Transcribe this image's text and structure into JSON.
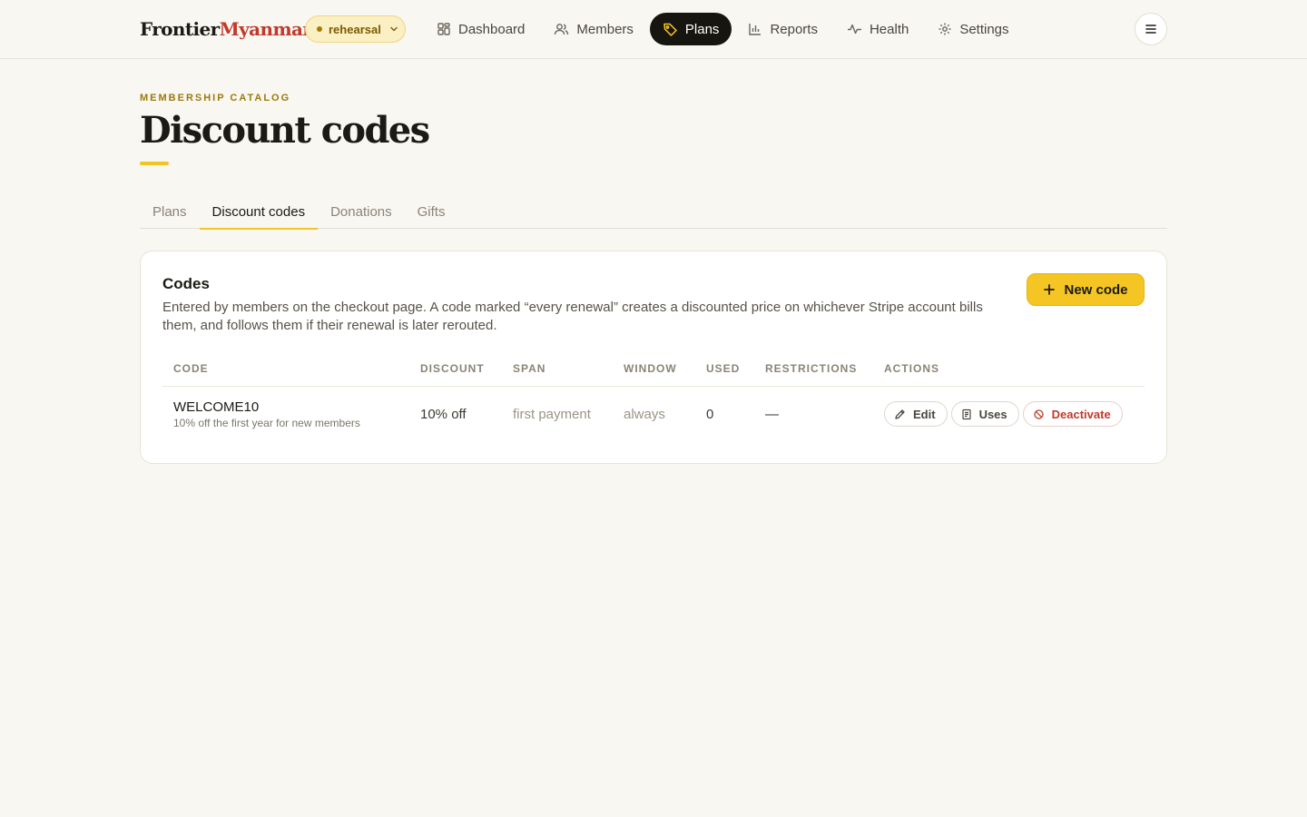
{
  "brand": {
    "part1": "Frontier",
    "part2": "Myanmar"
  },
  "environment": {
    "label": "rehearsal"
  },
  "nav": {
    "items": [
      {
        "label": "Dashboard",
        "icon": "grid-icon"
      },
      {
        "label": "Members",
        "icon": "users-icon"
      },
      {
        "label": "Plans",
        "icon": "tag-icon",
        "active": true
      },
      {
        "label": "Reports",
        "icon": "bar-chart-icon"
      },
      {
        "label": "Health",
        "icon": "pulse-icon"
      },
      {
        "label": "Settings",
        "icon": "gear-icon"
      }
    ]
  },
  "header": {
    "eyebrow": "MEMBERSHIP CATALOG",
    "title": "Discount codes"
  },
  "tabs": [
    {
      "label": "Plans"
    },
    {
      "label": "Discount codes",
      "active": true
    },
    {
      "label": "Donations"
    },
    {
      "label": "Gifts"
    }
  ],
  "codes_card": {
    "title": "Codes",
    "description": "Entered by members on the checkout page. A code marked “every renewal” creates a discounted price on whichever Stripe account bills them, and follows them if their renewal is later rerouted.",
    "new_button": "New code",
    "columns": [
      "CODE",
      "DISCOUNT",
      "SPAN",
      "WINDOW",
      "USED",
      "RESTRICTIONS",
      "ACTIONS"
    ],
    "rows": [
      {
        "code": "WELCOME10",
        "note": "10% off the first year for new members",
        "discount": "10% off",
        "span": "first payment",
        "window": "always",
        "used": "0",
        "restrictions": "—",
        "actions": {
          "edit": "Edit",
          "uses": "Uses",
          "deactivate": "Deactivate"
        }
      }
    ]
  },
  "colors": {
    "background": "#f9f7f2",
    "accent": "#f5c623",
    "active_nav": "#17150f",
    "brand_red": "#c0392b",
    "danger": "#c0392b"
  }
}
